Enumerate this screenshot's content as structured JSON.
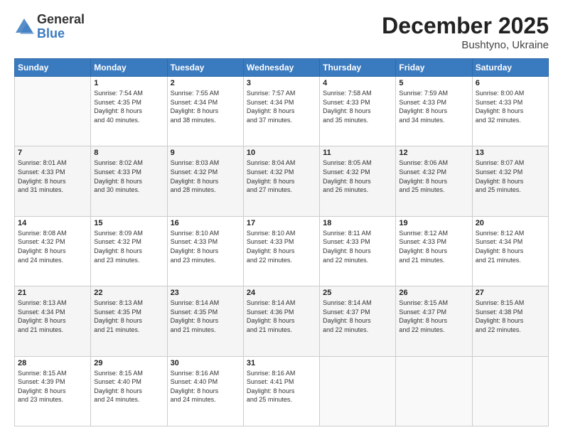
{
  "logo": {
    "general": "General",
    "blue": "Blue"
  },
  "header": {
    "month_year": "December 2025",
    "location": "Bushtyno, Ukraine"
  },
  "weekdays": [
    "Sunday",
    "Monday",
    "Tuesday",
    "Wednesday",
    "Thursday",
    "Friday",
    "Saturday"
  ],
  "weeks": [
    [
      {
        "day": "",
        "sunrise": "",
        "sunset": "",
        "daylight": ""
      },
      {
        "day": "1",
        "sunrise": "Sunrise: 7:54 AM",
        "sunset": "Sunset: 4:35 PM",
        "daylight": "Daylight: 8 hours and 40 minutes."
      },
      {
        "day": "2",
        "sunrise": "Sunrise: 7:55 AM",
        "sunset": "Sunset: 4:34 PM",
        "daylight": "Daylight: 8 hours and 38 minutes."
      },
      {
        "day": "3",
        "sunrise": "Sunrise: 7:57 AM",
        "sunset": "Sunset: 4:34 PM",
        "daylight": "Daylight: 8 hours and 37 minutes."
      },
      {
        "day": "4",
        "sunrise": "Sunrise: 7:58 AM",
        "sunset": "Sunset: 4:33 PM",
        "daylight": "Daylight: 8 hours and 35 minutes."
      },
      {
        "day": "5",
        "sunrise": "Sunrise: 7:59 AM",
        "sunset": "Sunset: 4:33 PM",
        "daylight": "Daylight: 8 hours and 34 minutes."
      },
      {
        "day": "6",
        "sunrise": "Sunrise: 8:00 AM",
        "sunset": "Sunset: 4:33 PM",
        "daylight": "Daylight: 8 hours and 32 minutes."
      }
    ],
    [
      {
        "day": "7",
        "sunrise": "Sunrise: 8:01 AM",
        "sunset": "Sunset: 4:33 PM",
        "daylight": "Daylight: 8 hours and 31 minutes."
      },
      {
        "day": "8",
        "sunrise": "Sunrise: 8:02 AM",
        "sunset": "Sunset: 4:33 PM",
        "daylight": "Daylight: 8 hours and 30 minutes."
      },
      {
        "day": "9",
        "sunrise": "Sunrise: 8:03 AM",
        "sunset": "Sunset: 4:32 PM",
        "daylight": "Daylight: 8 hours and 28 minutes."
      },
      {
        "day": "10",
        "sunrise": "Sunrise: 8:04 AM",
        "sunset": "Sunset: 4:32 PM",
        "daylight": "Daylight: 8 hours and 27 minutes."
      },
      {
        "day": "11",
        "sunrise": "Sunrise: 8:05 AM",
        "sunset": "Sunset: 4:32 PM",
        "daylight": "Daylight: 8 hours and 26 minutes."
      },
      {
        "day": "12",
        "sunrise": "Sunrise: 8:06 AM",
        "sunset": "Sunset: 4:32 PM",
        "daylight": "Daylight: 8 hours and 25 minutes."
      },
      {
        "day": "13",
        "sunrise": "Sunrise: 8:07 AM",
        "sunset": "Sunset: 4:32 PM",
        "daylight": "Daylight: 8 hours and 25 minutes."
      }
    ],
    [
      {
        "day": "14",
        "sunrise": "Sunrise: 8:08 AM",
        "sunset": "Sunset: 4:32 PM",
        "daylight": "Daylight: 8 hours and 24 minutes."
      },
      {
        "day": "15",
        "sunrise": "Sunrise: 8:09 AM",
        "sunset": "Sunset: 4:32 PM",
        "daylight": "Daylight: 8 hours and 23 minutes."
      },
      {
        "day": "16",
        "sunrise": "Sunrise: 8:10 AM",
        "sunset": "Sunset: 4:33 PM",
        "daylight": "Daylight: 8 hours and 23 minutes."
      },
      {
        "day": "17",
        "sunrise": "Sunrise: 8:10 AM",
        "sunset": "Sunset: 4:33 PM",
        "daylight": "Daylight: 8 hours and 22 minutes."
      },
      {
        "day": "18",
        "sunrise": "Sunrise: 8:11 AM",
        "sunset": "Sunset: 4:33 PM",
        "daylight": "Daylight: 8 hours and 22 minutes."
      },
      {
        "day": "19",
        "sunrise": "Sunrise: 8:12 AM",
        "sunset": "Sunset: 4:33 PM",
        "daylight": "Daylight: 8 hours and 21 minutes."
      },
      {
        "day": "20",
        "sunrise": "Sunrise: 8:12 AM",
        "sunset": "Sunset: 4:34 PM",
        "daylight": "Daylight: 8 hours and 21 minutes."
      }
    ],
    [
      {
        "day": "21",
        "sunrise": "Sunrise: 8:13 AM",
        "sunset": "Sunset: 4:34 PM",
        "daylight": "Daylight: 8 hours and 21 minutes."
      },
      {
        "day": "22",
        "sunrise": "Sunrise: 8:13 AM",
        "sunset": "Sunset: 4:35 PM",
        "daylight": "Daylight: 8 hours and 21 minutes."
      },
      {
        "day": "23",
        "sunrise": "Sunrise: 8:14 AM",
        "sunset": "Sunset: 4:35 PM",
        "daylight": "Daylight: 8 hours and 21 minutes."
      },
      {
        "day": "24",
        "sunrise": "Sunrise: 8:14 AM",
        "sunset": "Sunset: 4:36 PM",
        "daylight": "Daylight: 8 hours and 21 minutes."
      },
      {
        "day": "25",
        "sunrise": "Sunrise: 8:14 AM",
        "sunset": "Sunset: 4:37 PM",
        "daylight": "Daylight: 8 hours and 22 minutes."
      },
      {
        "day": "26",
        "sunrise": "Sunrise: 8:15 AM",
        "sunset": "Sunset: 4:37 PM",
        "daylight": "Daylight: 8 hours and 22 minutes."
      },
      {
        "day": "27",
        "sunrise": "Sunrise: 8:15 AM",
        "sunset": "Sunset: 4:38 PM",
        "daylight": "Daylight: 8 hours and 22 minutes."
      }
    ],
    [
      {
        "day": "28",
        "sunrise": "Sunrise: 8:15 AM",
        "sunset": "Sunset: 4:39 PM",
        "daylight": "Daylight: 8 hours and 23 minutes."
      },
      {
        "day": "29",
        "sunrise": "Sunrise: 8:15 AM",
        "sunset": "Sunset: 4:40 PM",
        "daylight": "Daylight: 8 hours and 24 minutes."
      },
      {
        "day": "30",
        "sunrise": "Sunrise: 8:16 AM",
        "sunset": "Sunset: 4:40 PM",
        "daylight": "Daylight: 8 hours and 24 minutes."
      },
      {
        "day": "31",
        "sunrise": "Sunrise: 8:16 AM",
        "sunset": "Sunset: 4:41 PM",
        "daylight": "Daylight: 8 hours and 25 minutes."
      },
      {
        "day": "",
        "sunrise": "",
        "sunset": "",
        "daylight": ""
      },
      {
        "day": "",
        "sunrise": "",
        "sunset": "",
        "daylight": ""
      },
      {
        "day": "",
        "sunrise": "",
        "sunset": "",
        "daylight": ""
      }
    ]
  ]
}
